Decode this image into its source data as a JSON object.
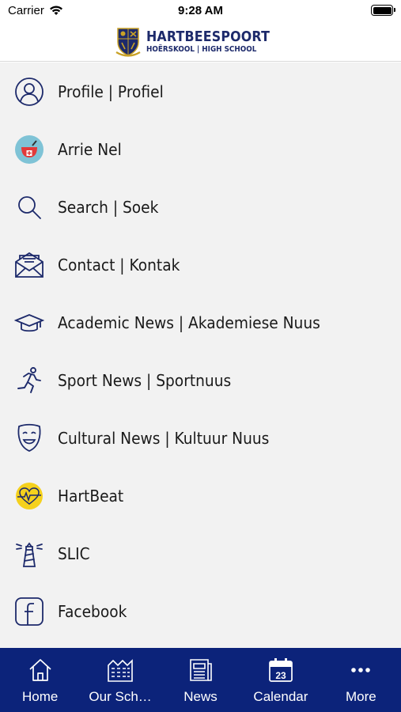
{
  "status_bar": {
    "carrier": "Carrier",
    "time": "9:28 AM",
    "battery_level": 1.0
  },
  "header": {
    "logo_title": "HARTBEESPOORT",
    "logo_subtitle": "HOËRSKOOL | HIGH SCHOOL",
    "brand_color": "#1d2a6b"
  },
  "menu": {
    "items": [
      {
        "label": "Profile | Profiel",
        "icon": "profile-icon"
      },
      {
        "label": "Arrie Nel",
        "icon": "arrie-nel-icon"
      },
      {
        "label": "Search | Soek",
        "icon": "search-icon"
      },
      {
        "label": "Contact | Kontak",
        "icon": "envelope-icon"
      },
      {
        "label": "Academic News | Akademiese Nuus",
        "icon": "graduation-cap-icon"
      },
      {
        "label": "Sport News | Sportnuus",
        "icon": "runner-icon"
      },
      {
        "label": "Cultural News | Kultuur Nuus",
        "icon": "theatre-mask-icon"
      },
      {
        "label": "HartBeat",
        "icon": "heartbeat-icon"
      },
      {
        "label": "SLIC",
        "icon": "lighthouse-icon"
      },
      {
        "label": "Facebook",
        "icon": "facebook-icon"
      }
    ],
    "icon_color": "#1d2a6b",
    "background": "#f2f2f2"
  },
  "tabs": {
    "background": "#0c237a",
    "items": [
      {
        "label": "Home",
        "icon": "home-icon"
      },
      {
        "label": "Our Sch…",
        "icon": "school-building-icon"
      },
      {
        "label": "News",
        "icon": "newspaper-icon"
      },
      {
        "label": "Calendar",
        "icon": "calendar-icon",
        "day": "23"
      },
      {
        "label": "More",
        "icon": "more-dots-icon"
      }
    ]
  }
}
